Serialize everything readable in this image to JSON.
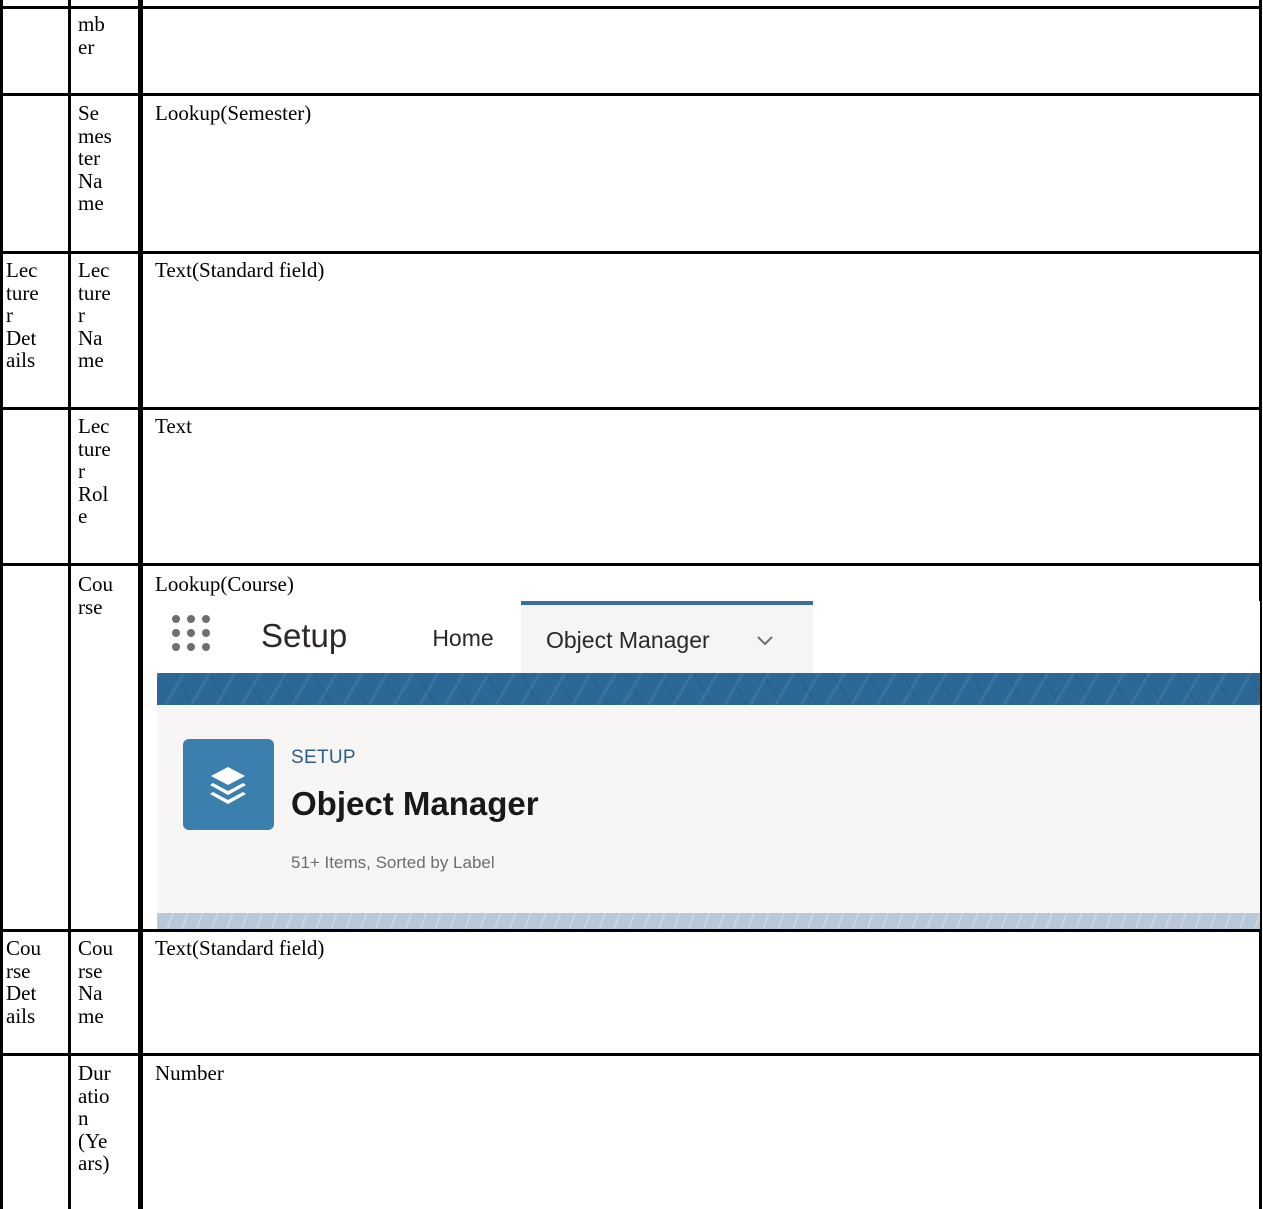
{
  "table": {
    "rows": [
      {
        "group": "",
        "field": "mb\ner",
        "type": ""
      },
      {
        "group": "",
        "field": "Se\nmes\nter\nNa\nme",
        "type": "Lookup(Semester)"
      },
      {
        "group": "Lec\nture\nr\nDet\nails",
        "field": "Lec\nture\nr\nNa\nme",
        "type": "Text(Standard field)"
      },
      {
        "group": "",
        "field": "Lec\nture\nr\nRol\ne",
        "type": "Text"
      },
      {
        "group": "",
        "field": "Cou\nrse",
        "type": "Lookup(Course)"
      },
      {
        "group": "Cou\nrse\nDet\nails",
        "field": "Cou\nrse\nNa\nme",
        "type": "Text(Standard field)"
      },
      {
        "group": "",
        "field": "Dur\natio\nn\n(Ye\nars)",
        "type": "Number"
      }
    ]
  },
  "screenshot": {
    "app_title": "Setup",
    "tab_home": "Home",
    "tab_object_manager": "Object Manager",
    "eyebrow": "SETUP",
    "page_title": "Object Manager",
    "item_count": "51+ Items, Sorted by Label",
    "icons": [
      "app-launcher-icon",
      "chevron-down-icon",
      "layers-icon"
    ],
    "colors": {
      "banner": "#2b6896",
      "active_tab_border": "#3a6f9d",
      "object_icon_bg": "#3a7fad"
    }
  }
}
